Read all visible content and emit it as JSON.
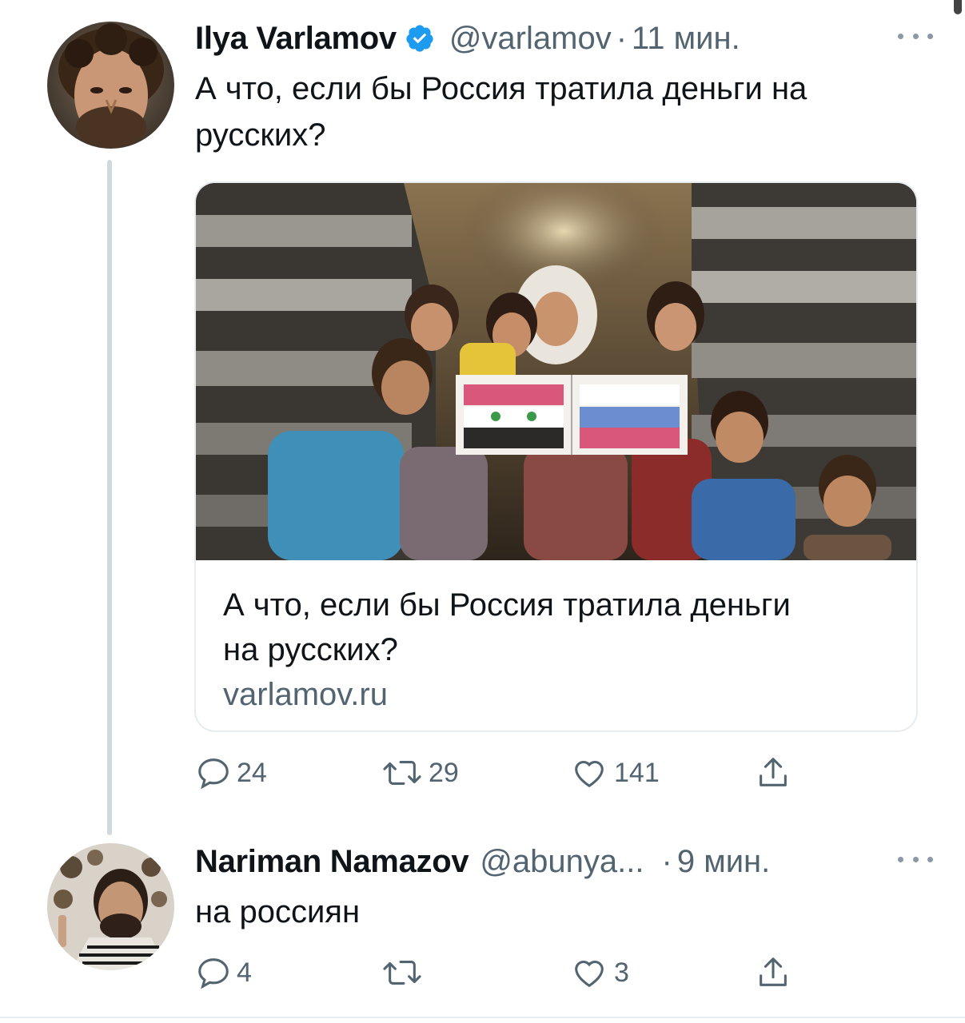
{
  "tweets": [
    {
      "display_name": "Ilya Varlamov",
      "verified": true,
      "handle": "@varlamov",
      "separator": "·",
      "time": "11 мин.",
      "text": "А что, если бы Россия тратила деньги на русских?",
      "card": {
        "title": "А что, если бы Россия тратила деньги на русских?",
        "domain": "varlamov.ru"
      },
      "actions": {
        "reply_count": "24",
        "retweet_count": "29",
        "like_count": "141"
      }
    },
    {
      "display_name": "Nariman Namazov",
      "verified": false,
      "handle": "@abunya...",
      "separator": "·",
      "time": "9 мин.",
      "text": "на россиян",
      "actions": {
        "reply_count": "4",
        "retweet_count": "",
        "like_count": "3"
      }
    }
  ],
  "icons": {
    "verified": "verified-badge-icon",
    "more": "more-dots-icon",
    "reply": "reply-bubble-icon",
    "retweet": "retweet-icon",
    "like": "heart-icon",
    "share": "share-icon"
  },
  "colors": {
    "verified_blue": "#1d9bf0",
    "secondary_text": "#536471",
    "primary_text": "#0f1419"
  }
}
